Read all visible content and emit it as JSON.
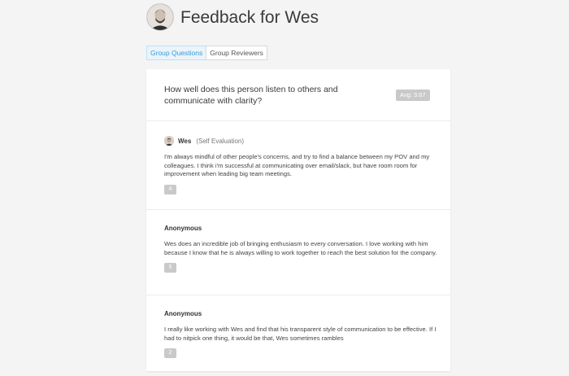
{
  "header": {
    "title": "Feedback for Wes"
  },
  "tabs": [
    {
      "label": "Group Questions",
      "active": true
    },
    {
      "label": "Group Reviewers",
      "active": false
    }
  ],
  "question": {
    "text": "How well does this person listen to others and communicate with clarity?",
    "average": "Avg: 3.67"
  },
  "responses": [
    {
      "reviewer": "Wes",
      "note": "(Self Evaluation)",
      "comment": "I'm always mindful of other people's concerns, and try to find a balance between my POV and my colleagues. I think i'm successful at communicating over email/slack, but have room room for improvement when leading big team meetings.",
      "score": "4"
    },
    {
      "reviewer": "Anonymous",
      "note": "",
      "comment": "Wes does an incredible job of bringing enthusiasm to every conversation. I love working with him because I know that he is always willing to work together to reach the best solution for the company.",
      "score": "5"
    },
    {
      "reviewer": "Anonymous",
      "note": "",
      "comment": "I really like working with Wes and find that his transparent style of communication to be effective. If I had to nitpick one thing, it would be that, Wes sometimes rambles",
      "score": "2"
    }
  ],
  "colors": {
    "accent": "#3a9ad9",
    "badge": "#c9c9c9",
    "background": "#f4f4f4"
  }
}
